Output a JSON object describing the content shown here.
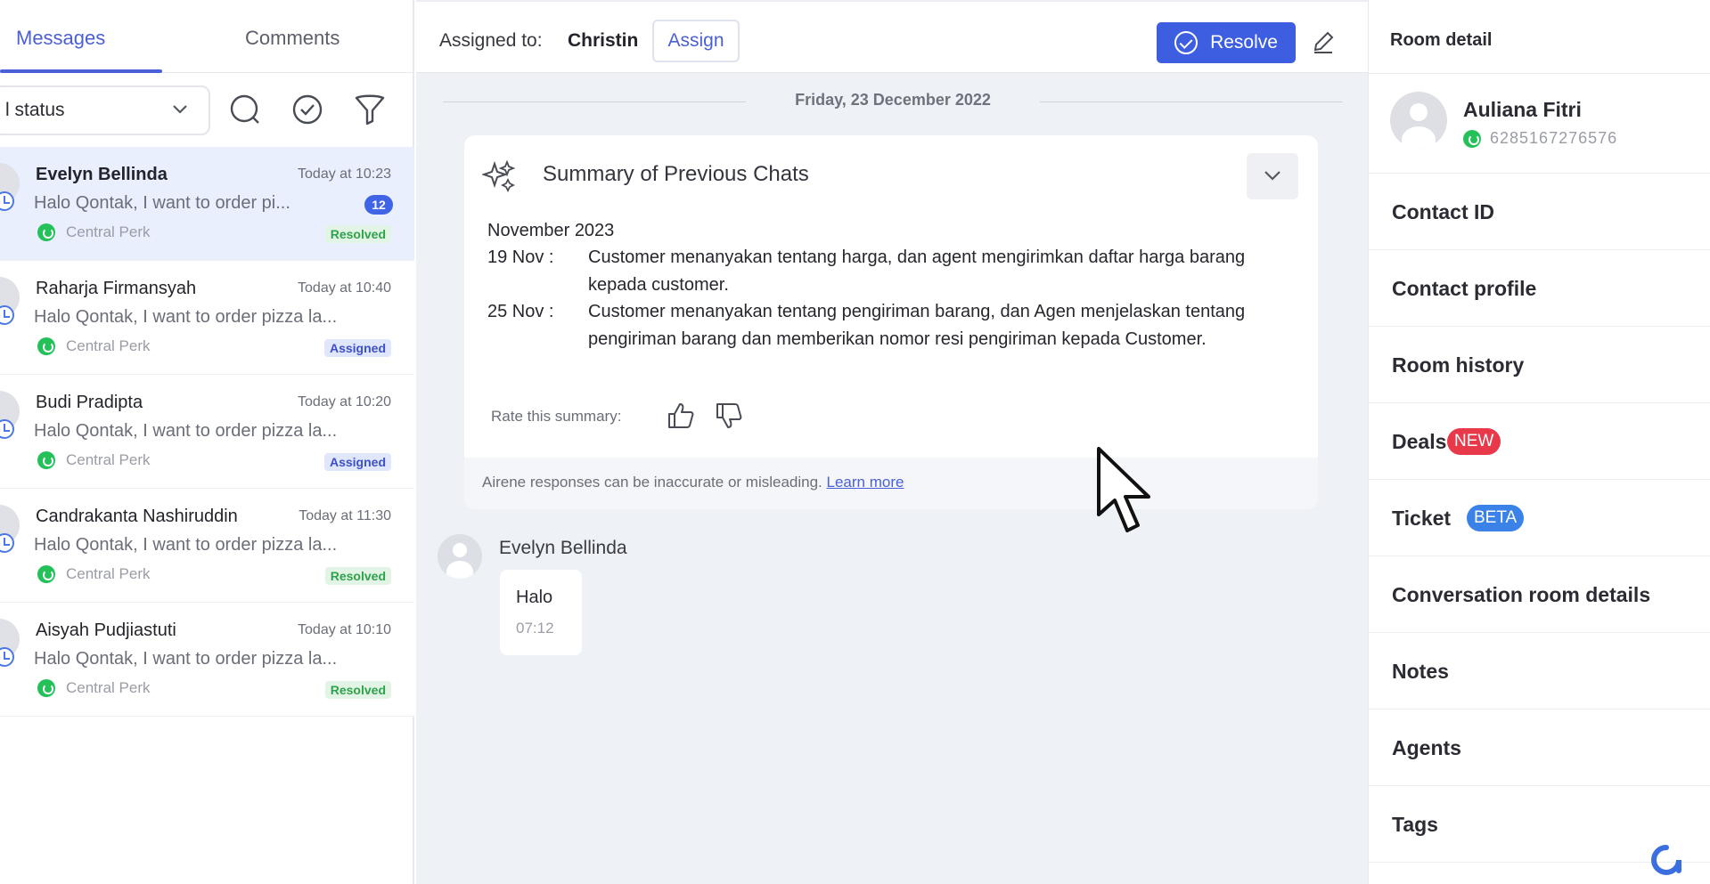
{
  "tabs": {
    "messages": "Messages",
    "comments": "Comments"
  },
  "filter": {
    "status_label": "l status"
  },
  "conversations": [
    {
      "name": "Evelyn Bellinda",
      "time": "Today at 10:23",
      "preview": "Halo Qontak, I want to order pi...",
      "channel": "Central Perk",
      "status": "Resolved",
      "unread": "12"
    },
    {
      "name": "Raharja Firmansyah",
      "time": "Today at 10:40",
      "preview": "Halo Qontak, I want to order pizza la...",
      "channel": "Central Perk",
      "status": "Assigned"
    },
    {
      "name": "Budi Pradipta",
      "time": "Today at 10:20",
      "preview": "Halo Qontak, I want to order pizza la...",
      "channel": "Central Perk",
      "status": "Assigned"
    },
    {
      "name": "Candrakanta Nashiruddin",
      "time": "Today at 11:30",
      "preview": "Halo Qontak, I want to order pizza la...",
      "channel": "Central Perk",
      "status": "Resolved"
    },
    {
      "name": "Aisyah Pudjiastuti",
      "time": "Today at 10:10",
      "preview": "Halo Qontak, I want to order pizza la...",
      "channel": "Central Perk",
      "status": "Resolved"
    }
  ],
  "header": {
    "assigned_label": "Assigned to:",
    "assigned_name": "Christin",
    "assign_button": "Assign",
    "resolve_button": "Resolve"
  },
  "chat": {
    "date": "Friday, 23 December 2022",
    "summary": {
      "title": "Summary of Previous Chats",
      "month": "November 2023",
      "entries": [
        {
          "date": "19 Nov :",
          "text": "Customer menanyakan tentang harga, dan agent mengirimkan daftar harga barang kepada customer."
        },
        {
          "date": "25 Nov :",
          "text": "Customer menanyakan tentang pengiriman barang, dan Agen menjelaskan tentang pengiriman barang dan memberikan nomor resi pengiriman kepada Customer."
        }
      ],
      "rate_label": "Rate this summary:",
      "disclaimer": "Airene responses can be inaccurate or misleading.",
      "learn_more": "Learn more"
    },
    "message": {
      "sender": "Evelyn Bellinda",
      "text": "Halo",
      "time": "07:12"
    }
  },
  "room_detail": {
    "title": "Room detail",
    "contact_name": "Auliana Fitri",
    "contact_phone": "6285167276576",
    "items": [
      {
        "label": "Contact ID"
      },
      {
        "label": "Contact profile"
      },
      {
        "label": "Room history"
      },
      {
        "label": "Deals",
        "tag": "NEW"
      },
      {
        "label": "Ticket",
        "tag": "BETA"
      },
      {
        "label": "Conversation room details"
      },
      {
        "label": "Notes"
      },
      {
        "label": "Agents"
      },
      {
        "label": "Tags"
      }
    ]
  },
  "colors": {
    "accent": "#3d5ee0",
    "resolved": "#2ea24a",
    "assigned": "#3d50c7",
    "whatsapp": "#24c15a",
    "new_tag": "#e8394a",
    "beta_tag": "#3b82e8"
  },
  "icons": [
    "search-icon",
    "check-circle-icon",
    "filter-icon",
    "chevron-down-icon",
    "edit-icon",
    "sparkle-icon",
    "thumbs-up-icon",
    "thumbs-down-icon",
    "whatsapp-icon",
    "clock-icon",
    "brand-logo-icon"
  ]
}
